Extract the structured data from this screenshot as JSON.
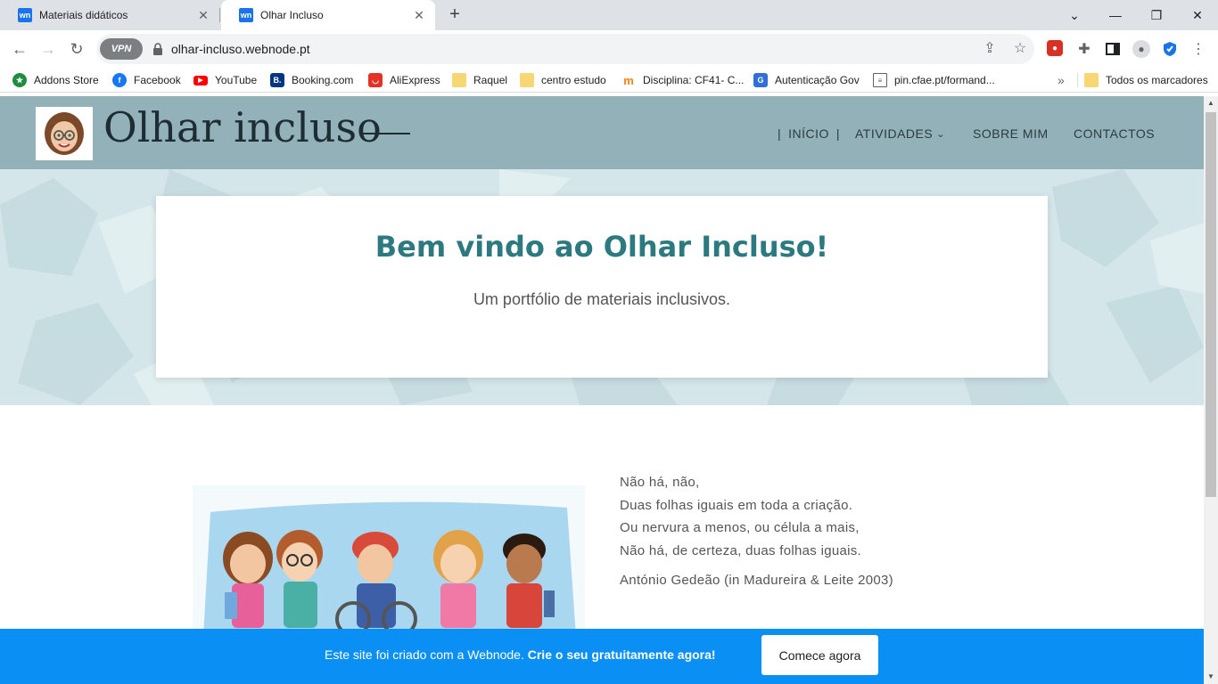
{
  "browser": {
    "tabs": [
      {
        "title": "Materiais didáticos",
        "favicon": "wn",
        "active": false
      },
      {
        "title": "Olhar Incluso",
        "favicon": "wn",
        "active": true
      }
    ],
    "new_tab": "+",
    "url": "olhar-incluso.webnode.pt",
    "vpn_label": "VPN",
    "bookmarks": [
      {
        "label": "Addons Store",
        "icon": "addons-store-icon",
        "color": "#1e8e3e"
      },
      {
        "label": "Facebook",
        "icon": "facebook-icon",
        "color": "#1877f2"
      },
      {
        "label": "YouTube",
        "icon": "youtube-icon",
        "color": "#ff0000"
      },
      {
        "label": "Booking.com",
        "icon": "booking-icon",
        "color": "#003580"
      },
      {
        "label": "AliExpress",
        "icon": "aliexpress-icon",
        "color": "#e43225"
      },
      {
        "label": "Raquel",
        "icon": "folder-icon",
        "color": "#f7d774"
      },
      {
        "label": "centro estudo",
        "icon": "folder-icon",
        "color": "#f7d774"
      },
      {
        "label": "Disciplina: CF41- C...",
        "icon": "moodle-icon",
        "color": "#f98012"
      },
      {
        "label": "Autenticação Gov",
        "icon": "gov-icon",
        "color": "#2f6fd6"
      },
      {
        "label": "pin.cfae.pt/formand...",
        "icon": "page-icon",
        "color": "#5f6368"
      }
    ],
    "bookmarks_overflow": "»",
    "all_bookmarks": "Todos os marcadores"
  },
  "site": {
    "title": "Olhar incluso",
    "nav": {
      "home": "INÍCIO",
      "activities": "ATIVIDADES",
      "about": "SOBRE MIM",
      "contacts": "CONTACTOS"
    },
    "hero": {
      "title": "Bem vindo ao Olhar Incluso!",
      "subtitle": "Um portfólio de materiais inclusivos."
    },
    "quote": {
      "lines": [
        "Não há, não,",
        "Duas folhas iguais em toda a criação.",
        "Ou nervura a menos, ou célula a mais,",
        "Não há, de certeza, duas folhas iguais."
      ],
      "author": "António Gedeão (in Madureira & Leite 2003)"
    },
    "promo": {
      "text": "Este site foi criado com a Webnode.",
      "bold": "Crie o seu gratuitamente agora!",
      "button": "Comece agora"
    }
  },
  "colors": {
    "header_bg": "#93b1b9",
    "hero_title": "#2c7a80",
    "promo_bg": "#0a8ff5"
  }
}
